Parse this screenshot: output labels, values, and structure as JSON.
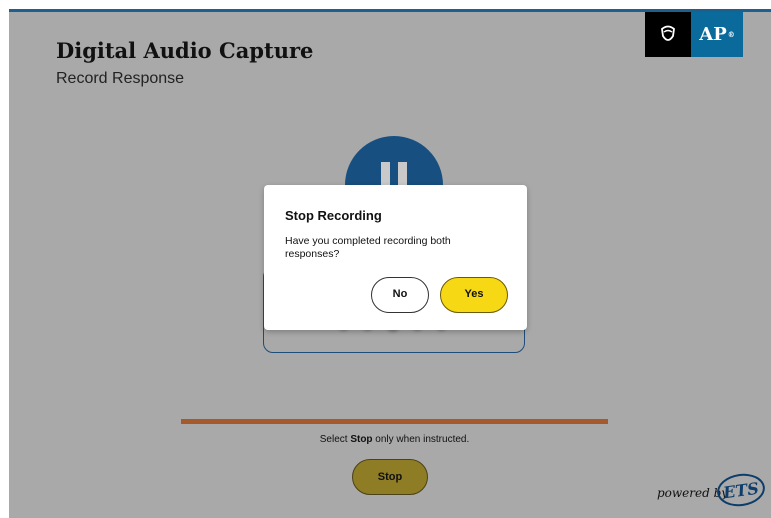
{
  "header": {
    "title": "Digital Audio Capture",
    "subtitle": "Record Response",
    "ap_logo_text": "AP",
    "ap_logo_sup": "®"
  },
  "recorder": {
    "instruction_prefix": "Select ",
    "instruction_bold": "Stop",
    "instruction_suffix": " only when instructed.",
    "stop_label": "Stop",
    "progress_color": "#a55a2c"
  },
  "footer": {
    "powered_by": "powered by",
    "ets_logo": "ETS"
  },
  "dialog": {
    "title": "Stop Recording",
    "message": "Have you completed recording both responses?",
    "no_label": "No",
    "yes_label": "Yes"
  },
  "colors": {
    "accent_blue": "#174f80",
    "yes_yellow": "#f7d814",
    "stop_dimmed": "#8e7d25"
  }
}
